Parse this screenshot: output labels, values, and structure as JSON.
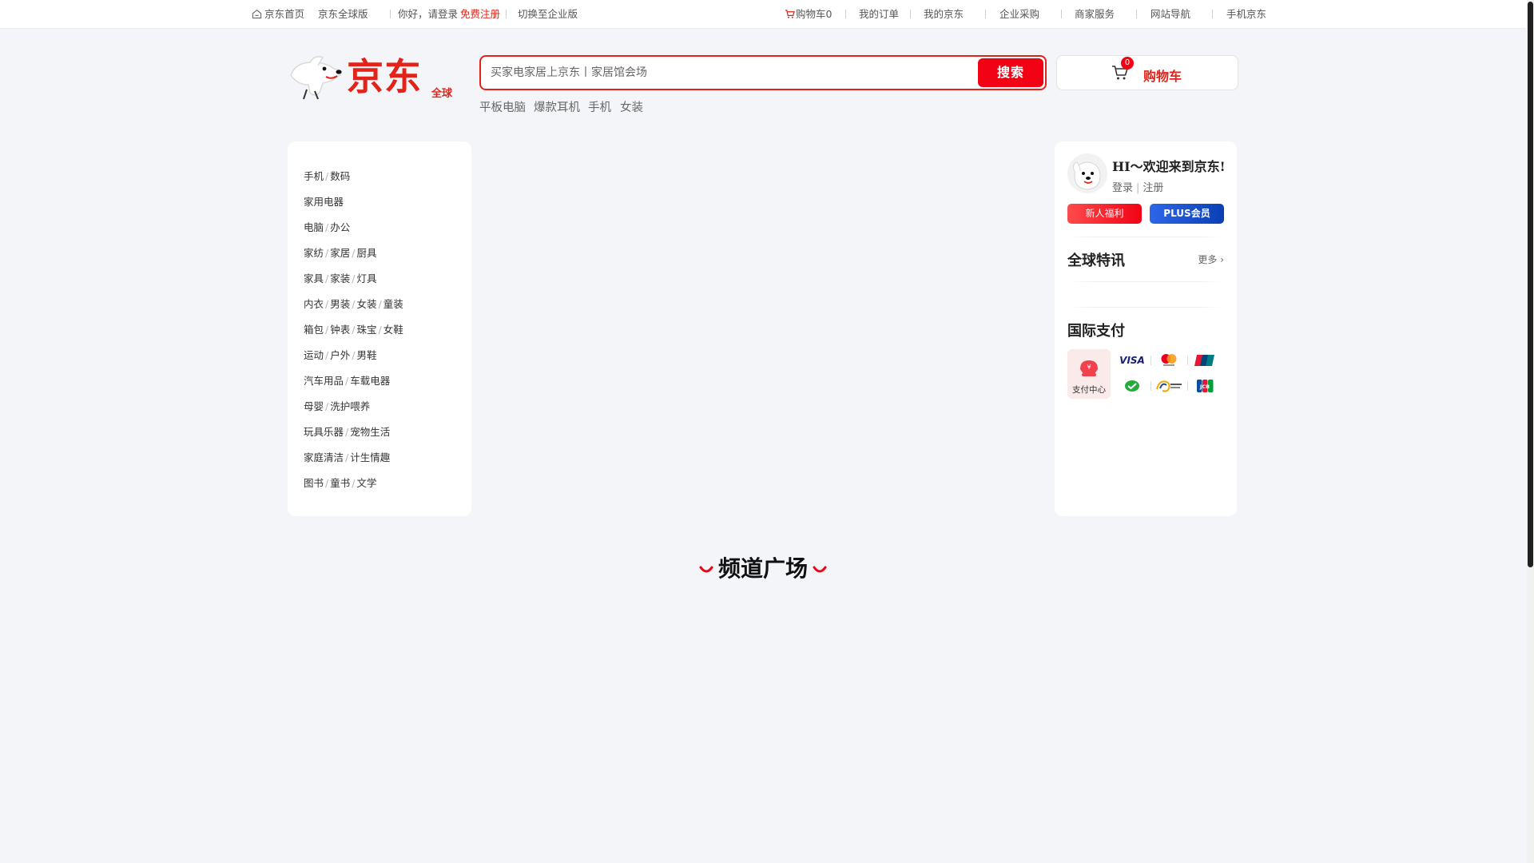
{
  "topbar": {
    "home": "京东首页",
    "global": "京东全球版",
    "greeting": "你好，请登录",
    "register": "免费注册",
    "switch": "切换至企业版",
    "cart": "购物车0",
    "orders": "我的订单",
    "my_jd": "我的京东",
    "enterprise": "企业采购",
    "merchant": "商家服务",
    "site_nav": "网站导航",
    "mobile": "手机京东"
  },
  "logo": {
    "text": "京东",
    "sub": "全球"
  },
  "search": {
    "placeholder": "买家电家居上京东丨家居馆会场",
    "button": "搜索"
  },
  "hot_words": [
    "平板电脑",
    "爆款耳机",
    "手机",
    "女装"
  ],
  "cart": {
    "count": "0",
    "label": "购物车"
  },
  "categories": [
    [
      "手机",
      "数码"
    ],
    [
      "家用电器"
    ],
    [
      "电脑",
      "办公"
    ],
    [
      "家纺",
      "家居",
      "厨具"
    ],
    [
      "家具",
      "家装",
      "灯具"
    ],
    [
      "内衣",
      "男装",
      "女装",
      "童装"
    ],
    [
      "箱包",
      "钟表",
      "珠宝",
      "女鞋"
    ],
    [
      "运动",
      "户外",
      "男鞋"
    ],
    [
      "汽车用品",
      "车载电器"
    ],
    [
      "母婴",
      "洗护喂养"
    ],
    [
      "玩具乐器",
      "宠物生活"
    ],
    [
      "家庭清洁",
      "计生情趣"
    ],
    [
      "图书",
      "童书",
      "文学"
    ]
  ],
  "category_separator": "/",
  "user": {
    "welcome": "HI～欢迎来到京东!",
    "login": "登录",
    "register": "注册",
    "login_separator": "|",
    "new_user": "新人福利",
    "plus": "PLUS会员"
  },
  "news": {
    "title": "全球特讯",
    "more": "更多"
  },
  "payment": {
    "title": "国际支付",
    "center": "支付中心",
    "methods": [
      "visa",
      "mastercard",
      "unionpay",
      "wechat-pay",
      "octopus",
      "jcb"
    ],
    "visa_text": "VISA",
    "jcb_text": "JCB"
  },
  "channel": {
    "title": "频道广场"
  },
  "colors": {
    "brand": "#e2231a",
    "button": "#f10215",
    "plus": "#0a3fb4",
    "background": "#f4f5f9"
  }
}
